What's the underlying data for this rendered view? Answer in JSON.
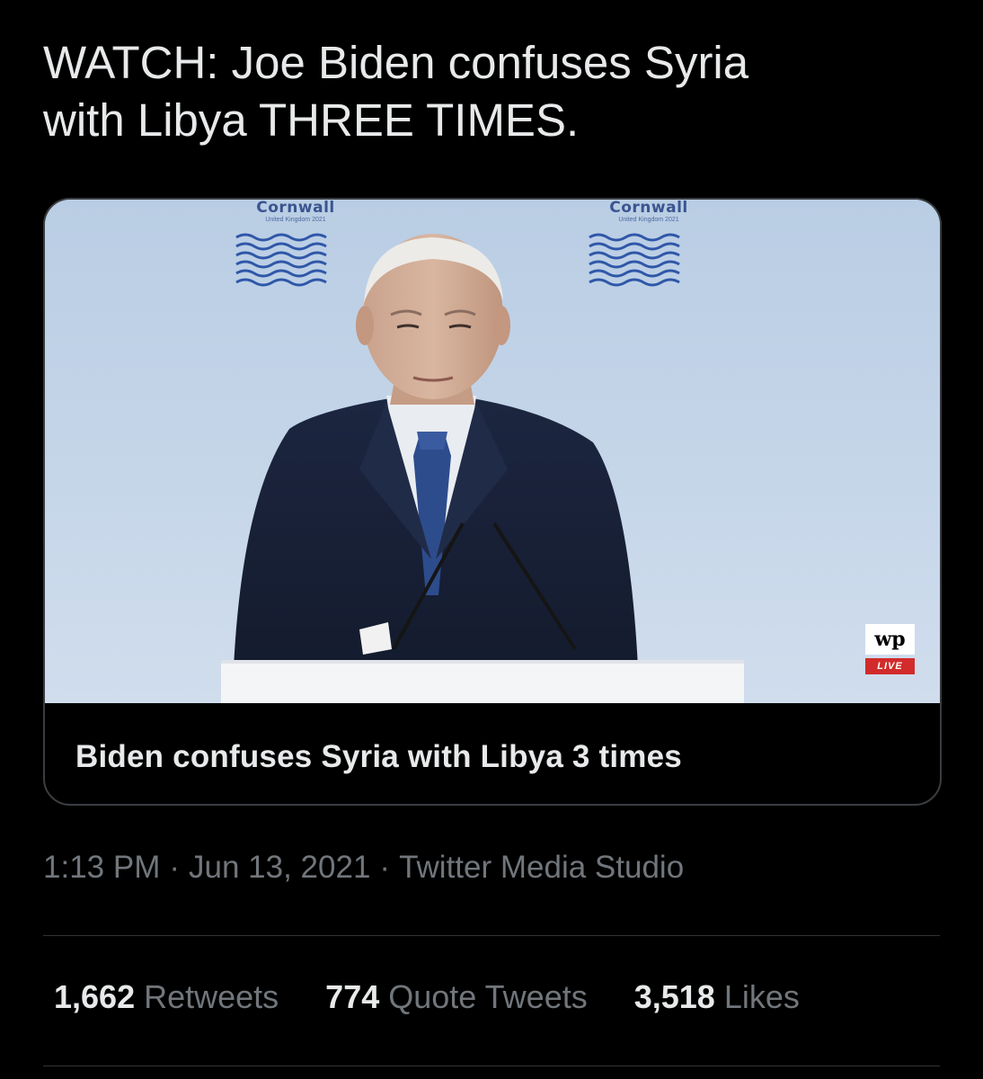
{
  "tweet": {
    "text_line1": "WATCH: Joe Biden confuses Syria",
    "text_line2": "with Libya THREE TIMES."
  },
  "media_card": {
    "title": "Biden confuses Syria with Libya 3 times",
    "backdrop_logo_left": {
      "word": "Cornwall",
      "sub": "United Kingdom 2021"
    },
    "backdrop_logo_right": {
      "word": "Cornwall",
      "sub": "United Kingdom 2021"
    },
    "watermark": {
      "mark": "wp",
      "live": "LIVE"
    }
  },
  "meta": {
    "time": "1:13 PM",
    "date": "Jun 13, 2021",
    "source": "Twitter Media Studio"
  },
  "stats": {
    "retweets_count": "1,662",
    "retweets_label": "Retweets",
    "quotes_count": "774",
    "quotes_label": "Quote Tweets",
    "likes_count": "3,518",
    "likes_label": "Likes"
  },
  "colors": {
    "background": "#000000",
    "text_primary": "#e7e9ea",
    "text_secondary": "#71767b",
    "divider": "#2f3336",
    "card_border": "#3a3d41"
  }
}
